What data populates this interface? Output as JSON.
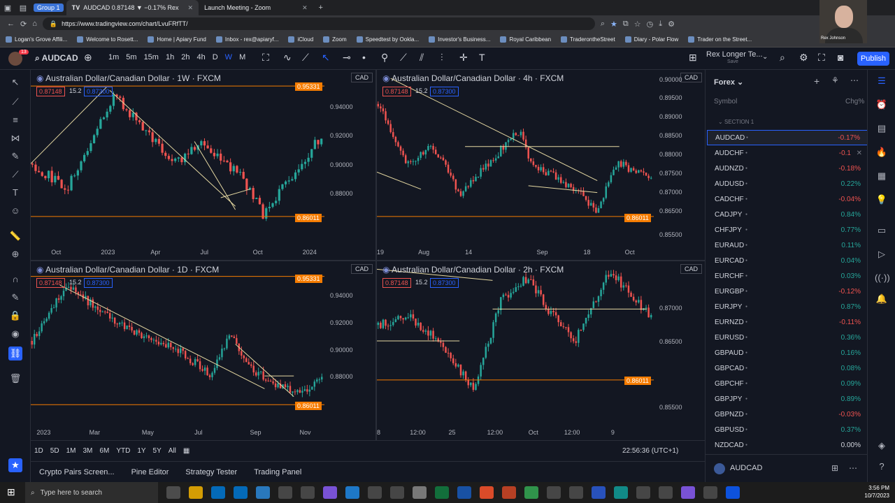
{
  "browser": {
    "group": "Group 1",
    "tabs": [
      {
        "label": "AUDCAD 0.87148 ▼ −0.17% Rex"
      },
      {
        "label": "Launch Meeting - Zoom"
      }
    ],
    "url": "https://www.tradingview.com/chart/LvuFRfTT/",
    "bookmarks": [
      "Logan's Grove Affili...",
      "Welcome to Rosett...",
      "Home | Apiary Fund",
      "Inbox - rex@apiaryf...",
      "iCloud",
      "Zoom",
      "Speedtest by Ookla...",
      "Investor's Business...",
      "Royal Caribbean",
      "TraderontheStreet",
      "Diary - Polar Flow",
      "Trader on the Street..."
    ]
  },
  "webcam": {
    "name": "Rex Johnson"
  },
  "toolbar": {
    "badge": "13",
    "symbol": "AUDCAD",
    "timeframes": [
      "1m",
      "5m",
      "15m",
      "1h",
      "2h",
      "4h",
      "D",
      "W",
      "M"
    ],
    "active_timeframe": "W",
    "layout_name": "Rex Longer Te...",
    "layout_sub": "Save",
    "publish": "Publish"
  },
  "charts": [
    {
      "title": "Australian Dollar/Canadian Dollar · 1W · FXCM",
      "sell": "0.87148",
      "spread": "15.2",
      "buy": "0.87300",
      "currency": "CAD",
      "price_ticks": [
        "0.94000",
        "0.92000",
        "0.90000",
        "0.88000"
      ],
      "tags": [
        "0.95331",
        "0.86011"
      ],
      "time_ticks": [
        "Oct",
        "2023",
        "Apr",
        "Jul",
        "Oct",
        "2024"
      ]
    },
    {
      "title": "Australian Dollar/Canadian Dollar · 4h · FXCM",
      "sell": "0.87148",
      "spread": "15.2",
      "buy": "0.87300",
      "currency": "CAD",
      "price_ticks": [
        "0.90000",
        "0.89500",
        "0.89000",
        "0.88500",
        "0.88000",
        "0.87500",
        "0.87000",
        "0.86500",
        "0.85500"
      ],
      "tags": [
        "0.86011"
      ],
      "time_ticks": [
        "19",
        "Aug",
        "14",
        "Sep",
        "18",
        "Oct"
      ]
    },
    {
      "title": "Australian Dollar/Canadian Dollar · 1D · FXCM",
      "sell": "0.87148",
      "spread": "15.2",
      "buy": "0.87300",
      "currency": "CAD",
      "price_ticks": [
        "0.94000",
        "0.92000",
        "0.90000",
        "0.88000"
      ],
      "tags": [
        "0.95331",
        "0.86011"
      ],
      "time_ticks": [
        "2023",
        "Mar",
        "May",
        "Jul",
        "Sep",
        "Nov"
      ]
    },
    {
      "title": "Australian Dollar/Canadian Dollar · 2h · FXCM",
      "sell": "0.87148",
      "spread": "15.2",
      "buy": "0.87300",
      "currency": "CAD",
      "price_ticks": [
        "0.87000",
        "0.86500",
        "0.85500"
      ],
      "tags": [
        "0.86011"
      ],
      "time_ticks": [
        "8",
        "12:00",
        "25",
        "12:00",
        "Oct",
        "12:00",
        "9"
      ]
    }
  ],
  "range_bar": {
    "ranges": [
      "1D",
      "5D",
      "1M",
      "3M",
      "6M",
      "YTD",
      "1Y",
      "5Y",
      "All"
    ],
    "clock": "22:56:36 (UTC+1)"
  },
  "bottom_panels": [
    "Crypto Pairs Screen...",
    "Pine Editor",
    "Strategy Tester",
    "Trading Panel"
  ],
  "watchlist": {
    "title": "Forex",
    "col_symbol": "Symbol",
    "col_change": "Chg%",
    "section": "SECTION 1",
    "items": [
      {
        "sym": "AUDCAD",
        "chg": "-0.17%"
      },
      {
        "sym": "AUDCHF",
        "chg": "-0.1"
      },
      {
        "sym": "AUDNZD",
        "chg": "-0.18%"
      },
      {
        "sym": "AUDUSD",
        "chg": "0.22%"
      },
      {
        "sym": "CADCHF",
        "chg": "-0.04%"
      },
      {
        "sym": "CADJPY",
        "chg": "0.84%"
      },
      {
        "sym": "CHFJPY",
        "chg": "0.77%"
      },
      {
        "sym": "EURAUD",
        "chg": "0.11%"
      },
      {
        "sym": "EURCAD",
        "chg": "0.04%"
      },
      {
        "sym": "EURCHF",
        "chg": "0.03%"
      },
      {
        "sym": "EURGBP",
        "chg": "-0.12%"
      },
      {
        "sym": "EURJPY",
        "chg": "0.87%"
      },
      {
        "sym": "EURNZD",
        "chg": "-0.11%"
      },
      {
        "sym": "EURUSD",
        "chg": "0.36%"
      },
      {
        "sym": "GBPAUD",
        "chg": "0.16%"
      },
      {
        "sym": "GBPCAD",
        "chg": "0.08%"
      },
      {
        "sym": "GBPCHF",
        "chg": "0.09%"
      },
      {
        "sym": "GBPJPY",
        "chg": "0.89%"
      },
      {
        "sym": "GBPNZD",
        "chg": "-0.03%"
      },
      {
        "sym": "GBPUSD",
        "chg": "0.37%"
      },
      {
        "sym": "NZDCAD",
        "chg": "0.00%"
      }
    ],
    "footer_symbol": "AUDCAD"
  },
  "taskbar": {
    "search": "Type here to search",
    "time": "3:56 PM",
    "date": "10/7/2023"
  },
  "colors": {
    "up": "#26a69a",
    "down": "#ef5350",
    "accent": "#2962ff",
    "level": "#f57c00",
    "trend": "#e6d9a2"
  }
}
